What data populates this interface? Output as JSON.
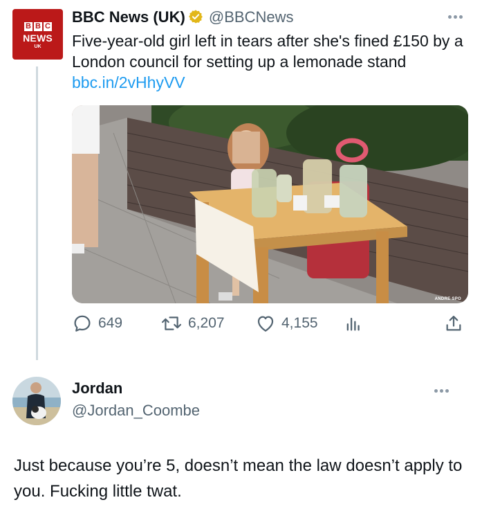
{
  "tweet": {
    "avatar": {
      "logo_letters": [
        "B",
        "B",
        "C"
      ],
      "logo_word": "NEWS",
      "logo_sub": "UK",
      "bg_color": "#bb1919"
    },
    "display_name": "BBC News (UK)",
    "verified_icon": "gold-verified-badge",
    "handle": "@BBCNews",
    "text": "Five-year-old girl left in tears after she's fined £150 by a London council for setting up a lemonade stand ",
    "link": "bbc.in/2vHhyVV",
    "photo_watermark": "ANDRE SPO",
    "stats": {
      "replies": "649",
      "retweets": "6,207",
      "likes": "4,155"
    }
  },
  "reply": {
    "display_name": "Jordan",
    "handle": "@Jordan_Coombe",
    "text": "Just because you’re 5, doesn’t mean the law doesn’t apply to you. Fucking little twat."
  },
  "colors": {
    "link": "#1d9bf0",
    "secondary_text": "#536471",
    "thread_line": "#cfd9de",
    "verified_gold": "#e2b719"
  }
}
